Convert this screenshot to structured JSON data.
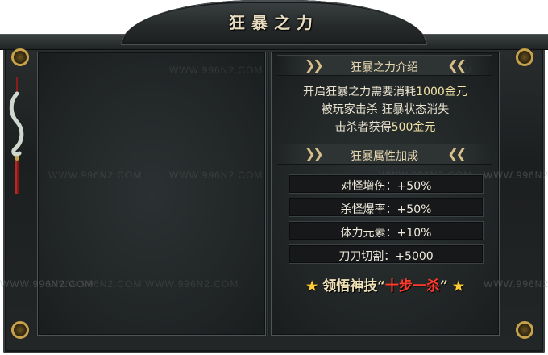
{
  "title": "狂暴之力",
  "intro_section": {
    "header": "狂暴之力介绍",
    "lines": [
      {
        "text": "开启狂暴之力需要消耗",
        "highlight": "1000金元"
      },
      {
        "text": "被玩家击杀 狂暴状态消失",
        "highlight": ""
      },
      {
        "text": "击杀者获得",
        "highlight": "500金元"
      }
    ]
  },
  "attr_section": {
    "header": "狂暴属性加成",
    "rows": [
      "对怪增伤：+50%",
      "杀怪爆率：+50%",
      "体力元素：+10%",
      "刀刀切割：+5000"
    ]
  },
  "skill": {
    "prefix": "领悟神技",
    "open_quote": "“",
    "name": "十步一杀",
    "close_quote": "”"
  },
  "watermark_text": "WWW.996N2.COM",
  "colors": {
    "frame": "#1f2223",
    "gold": "#c7a24a",
    "skill_red": "#ff3a2a",
    "text": "#e9e2cf"
  }
}
